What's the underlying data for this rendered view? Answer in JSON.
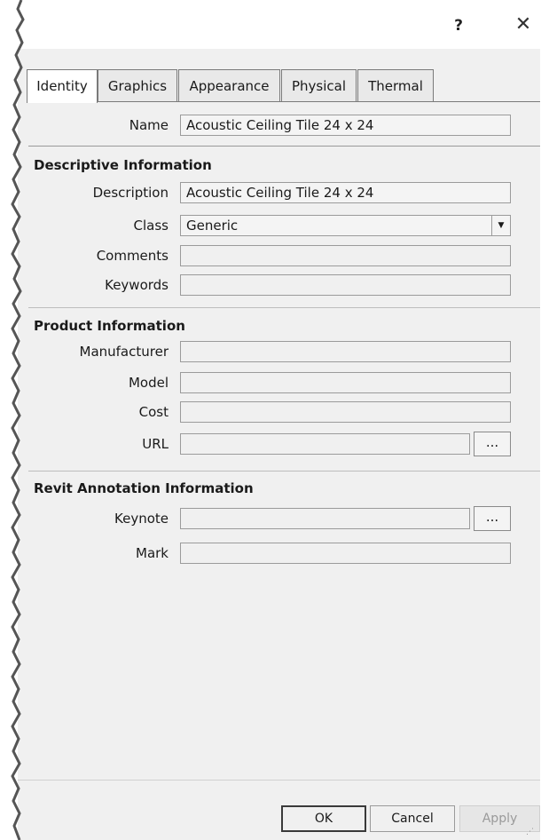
{
  "titlebar": {
    "help_label": "?",
    "close_icon": "close-icon"
  },
  "tabs": [
    {
      "label": "Identity",
      "active": true
    },
    {
      "label": "Graphics",
      "active": false
    },
    {
      "label": "Appearance",
      "active": false
    },
    {
      "label": "Physical",
      "active": false
    },
    {
      "label": "Thermal",
      "active": false
    }
  ],
  "name_row": {
    "label": "Name",
    "value": "Acoustic Ceiling Tile 24 x 24"
  },
  "descriptive": {
    "title": "Descriptive Information",
    "description": {
      "label": "Description",
      "value": "Acoustic Ceiling Tile 24 x 24"
    },
    "class": {
      "label": "Class",
      "value": "Generic"
    },
    "comments": {
      "label": "Comments",
      "value": ""
    },
    "keywords": {
      "label": "Keywords",
      "value": ""
    }
  },
  "product": {
    "title": "Product Information",
    "manufacturer": {
      "label": "Manufacturer",
      "value": ""
    },
    "model": {
      "label": "Model",
      "value": ""
    },
    "cost": {
      "label": "Cost",
      "value": ""
    },
    "url": {
      "label": "URL",
      "value": "",
      "browse_label": "..."
    }
  },
  "revit": {
    "title": "Revit Annotation Information",
    "keynote": {
      "label": "Keynote",
      "value": "",
      "browse_label": "..."
    },
    "mark": {
      "label": "Mark",
      "value": ""
    }
  },
  "footer": {
    "ok_label": "OK",
    "cancel_label": "Cancel",
    "apply_label": "Apply"
  }
}
